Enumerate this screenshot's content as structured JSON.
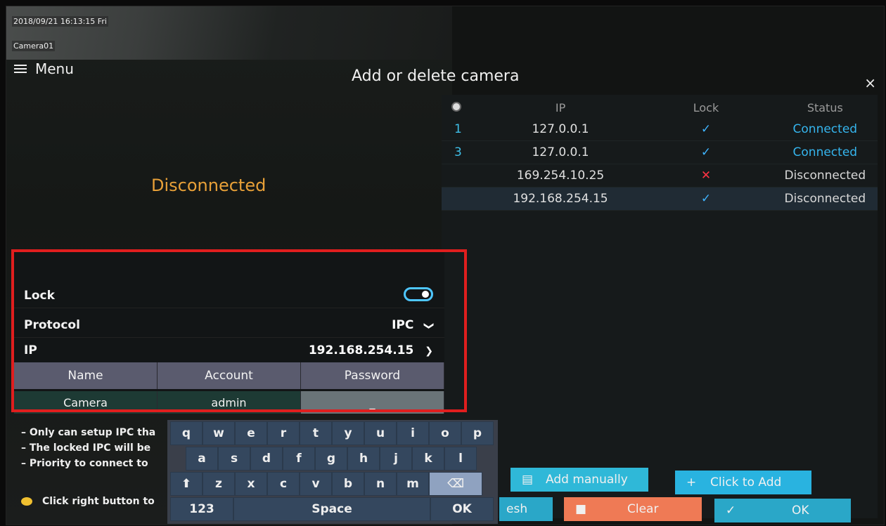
{
  "osd": {
    "datetime": "2018/09/21 16:13:15 Fri",
    "camera": "Camera01"
  },
  "menu": {
    "label": "Menu"
  },
  "preview": {
    "status": "Disconnected"
  },
  "dialog": {
    "title": "Add or delete camera",
    "close": "×"
  },
  "table": {
    "headers": {
      "ip": "IP",
      "lock": "Lock",
      "status": "Status"
    },
    "rows": [
      {
        "idx": "1",
        "ip": "127.0.0.1",
        "lock": "✓",
        "status": "Connected"
      },
      {
        "idx": "3",
        "ip": "127.0.0.1",
        "lock": "✓",
        "status": "Connected"
      },
      {
        "idx": "",
        "ip": "169.254.10.25",
        "lock": "✕",
        "status": "Disconnected"
      },
      {
        "idx": "",
        "ip": "192.168.254.15",
        "lock": "✓",
        "status": "Disconnected"
      }
    ]
  },
  "edit": {
    "lock_label": "Lock",
    "protocol_label": "Protocol",
    "protocol_value": "IPC",
    "protocol_chevron": "❯",
    "ip_label": "IP",
    "ip_value": "192.168.254.15",
    "ip_chevron": "❯",
    "col_name": "Name",
    "col_account": "Account",
    "col_password": "Password",
    "name_value": "Camera",
    "account_value": "admin",
    "password_value": "_"
  },
  "notes": [
    "– Only can setup IPC tha",
    "– The locked IPC will be",
    "– Priority to connect to"
  ],
  "hint": {
    "text": "Click right button to"
  },
  "keyboard": {
    "row1": [
      "q",
      "w",
      "e",
      "r",
      "t",
      "y",
      "u",
      "i",
      "o",
      "p"
    ],
    "row2": [
      "a",
      "s",
      "d",
      "f",
      "g",
      "h",
      "j",
      "k",
      "l"
    ],
    "row3": [
      "⬆",
      "z",
      "x",
      "c",
      "v",
      "b",
      "n",
      "m",
      "⌫"
    ],
    "key_123": "123",
    "key_space": "Space",
    "key_ok": "OK"
  },
  "buttons": {
    "add_manually": "Add manually",
    "click_to_add": "Click to Add",
    "refresh": "esh",
    "clear": "Clear",
    "ok": "OK"
  },
  "colors": {
    "accent": "#35b5ee",
    "warning": "#e8a038",
    "highlight_border": "#e01e1e"
  }
}
